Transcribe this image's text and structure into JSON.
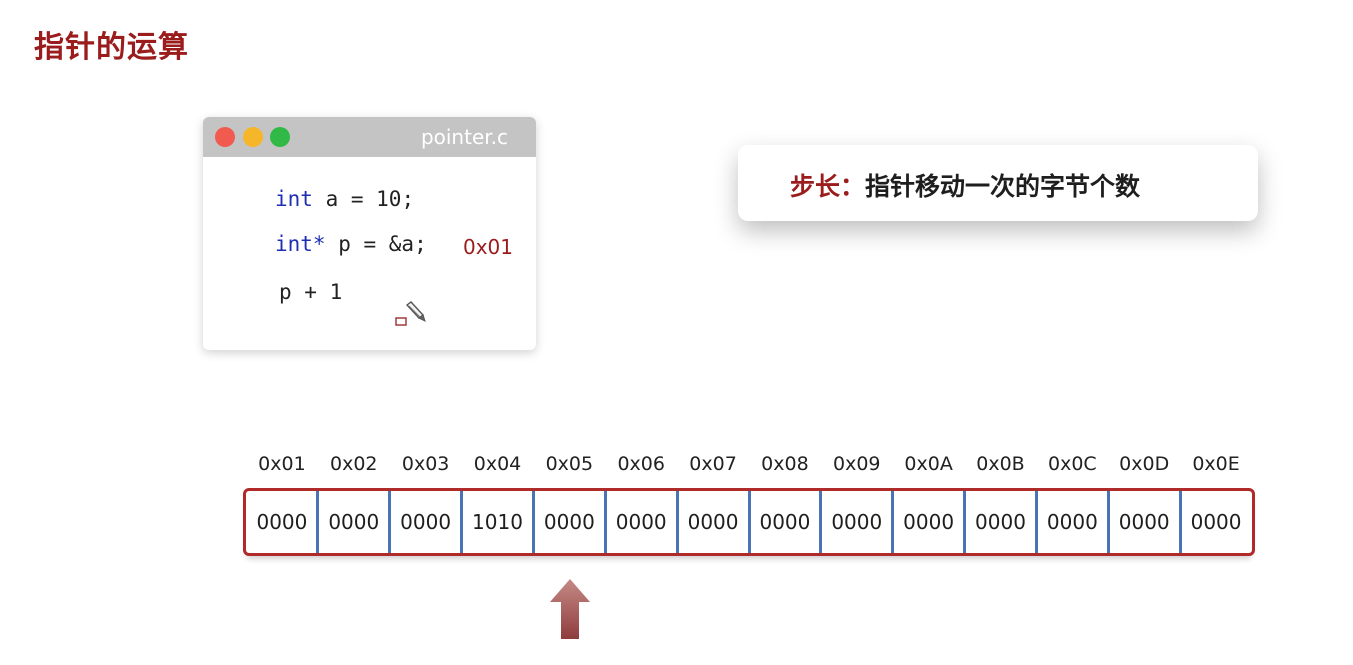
{
  "page": {
    "title": "指针的运算"
  },
  "code_window": {
    "filename": "pointer.c",
    "lines": [
      {
        "keyword": "int",
        "rest": " a = 10;"
      },
      {
        "keyword": "int*",
        "rest": " p = &a;"
      },
      {
        "keyword": "",
        "rest": "p + 1"
      }
    ],
    "annotation": "0x01",
    "icons": [
      "close-dot",
      "minimize-dot",
      "maximize-dot",
      "pencil-cursor-icon"
    ],
    "colors": {
      "bar": "#c4c4c4",
      "keyword": "#1f2fb3",
      "annotation": "#9b1c1c"
    }
  },
  "info_card": {
    "label": "步长：",
    "text": "指针移动一次的字节个数"
  },
  "memory": {
    "addresses": [
      "0x01",
      "0x02",
      "0x03",
      "0x04",
      "0x05",
      "0x06",
      "0x07",
      "0x08",
      "0x09",
      "0x0A",
      "0x0B",
      "0x0C",
      "0x0D",
      "0x0E"
    ],
    "values": [
      "0000",
      "0000",
      "0000",
      "1010",
      "0000",
      "0000",
      "0000",
      "0000",
      "0000",
      "0000",
      "0000",
      "0000",
      "0000",
      "0000"
    ],
    "pointer_index": 4,
    "colors": {
      "border": "#b02a2a",
      "divider": "#4a73b3",
      "arrow": "#a94d4d"
    }
  }
}
